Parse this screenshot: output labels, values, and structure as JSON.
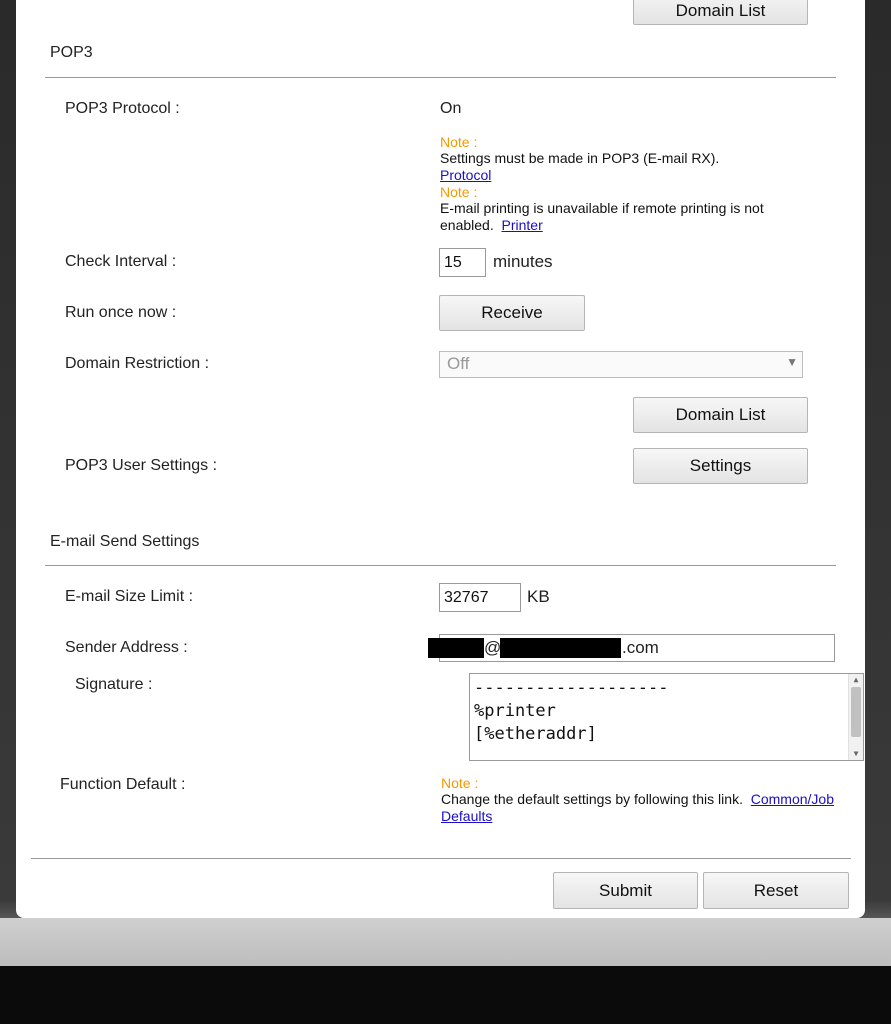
{
  "top": {
    "domain_list_button": "Domain List"
  },
  "pop3": {
    "section_title": "POP3",
    "protocol_label": "POP3 Protocol :",
    "protocol_value": "On",
    "note1_label": "Note :",
    "note1_text": "Settings must be made in POP3 (E-mail RX).",
    "note1_link": "Protocol",
    "note2_label": "Note :",
    "note2_text": "E-mail printing is unavailable if remote printing is not enabled.",
    "note2_link": "Printer",
    "check_interval_label": "Check Interval :",
    "check_interval_value": "15",
    "check_interval_unit": "minutes",
    "run_once_label": "Run once now :",
    "receive_button": "Receive",
    "domain_restriction_label": "Domain Restriction :",
    "domain_restriction_value": "Off",
    "domain_list_button": "Domain List",
    "user_settings_label": "POP3 User Settings :",
    "settings_button": "Settings"
  },
  "send": {
    "section_title": "E-mail Send Settings",
    "size_limit_label": "E-mail Size Limit :",
    "size_limit_value": "32767",
    "size_limit_unit": "KB",
    "sender_label": "Sender Address :",
    "sender_at": "@",
    "sender_suffix": ".com",
    "signature_label": "Signature :",
    "signature_line1": "-------------------",
    "signature_line2": "%printer",
    "signature_line3": "[%etheraddr]",
    "function_default_label": "Function Default :",
    "note_label": "Note :",
    "note_text": "Change the default settings by following this link.",
    "note_link": "Common/Job Defaults"
  },
  "footer": {
    "submit_button": "Submit",
    "reset_button": "Reset"
  }
}
